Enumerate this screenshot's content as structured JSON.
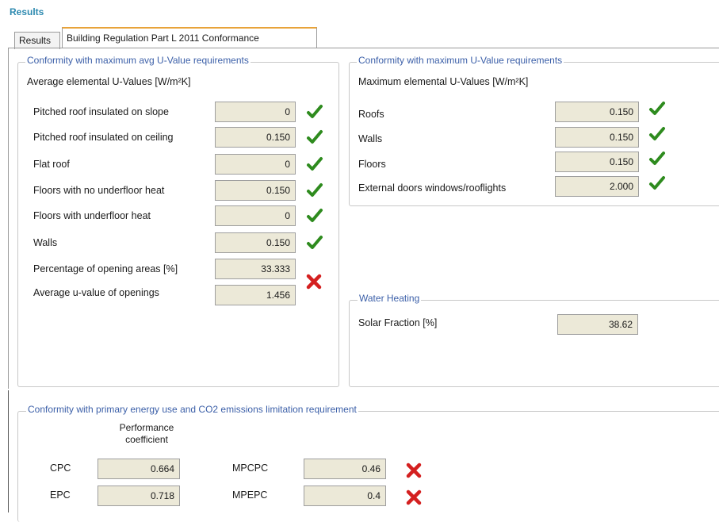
{
  "header": {
    "title": "Results"
  },
  "tabs": [
    {
      "label": "Results",
      "active": false
    },
    {
      "label": "Building Regulation Part L 2011 Conformance",
      "active": true
    }
  ],
  "avg_panel": {
    "legend": "Conformity with maximum avg U-Value requirements",
    "subtitle": "Average elemental U-Values [W/m²K]",
    "rows": [
      {
        "label": "Pitched roof insulated on slope",
        "value": "0",
        "status": "pass"
      },
      {
        "label": "Pitched roof insulated on ceiling",
        "value": "0.150",
        "status": "pass"
      },
      {
        "label": "Flat roof",
        "value": "0",
        "status": "pass"
      },
      {
        "label": "Floors with no underfloor heat",
        "value": "0.150",
        "status": "pass"
      },
      {
        "label": "Floors with underfloor heat",
        "value": "0",
        "status": "pass"
      },
      {
        "label": "Walls",
        "value": "0.150",
        "status": "pass"
      },
      {
        "label": "Percentage of opening areas [%]",
        "value": "33.333",
        "status": "fail"
      },
      {
        "label": "Average u-value of openings",
        "value": "1.456",
        "status": ""
      }
    ]
  },
  "max_panel": {
    "legend": "Conformity with maximum U-Value requirements",
    "subtitle": "Maximum elemental U-Values [W/m²K]",
    "rows": [
      {
        "label": "Roofs",
        "value": "0.150",
        "status": "pass"
      },
      {
        "label": "Walls",
        "value": "0.150",
        "status": "pass"
      },
      {
        "label": "Floors",
        "value": "0.150",
        "status": "pass"
      },
      {
        "label": "External doors windows/rooflights",
        "value": "2.000",
        "status": "pass"
      }
    ]
  },
  "water_panel": {
    "legend": "Water Heating",
    "solar_label": "Solar Fraction [%]",
    "solar_value": "38.62"
  },
  "energy_panel": {
    "legend": "Conformity with primary energy use and CO2 emissions limitation requirement",
    "column_header_line1": "Performance",
    "column_header_line2": "coefficient",
    "rows": [
      {
        "label": "CPC",
        "value": "0.664",
        "limit_label": "MPCPC",
        "limit_value": "0.46",
        "status": "fail"
      },
      {
        "label": "EPC",
        "value": "0.718",
        "limit_label": "MPEPC",
        "limit_value": "0.4",
        "status": "fail"
      }
    ]
  },
  "colors": {
    "pass": "#2e8b1e",
    "fail": "#d42020",
    "legend": "#3b5fa8",
    "title": "#2e8ab0"
  }
}
